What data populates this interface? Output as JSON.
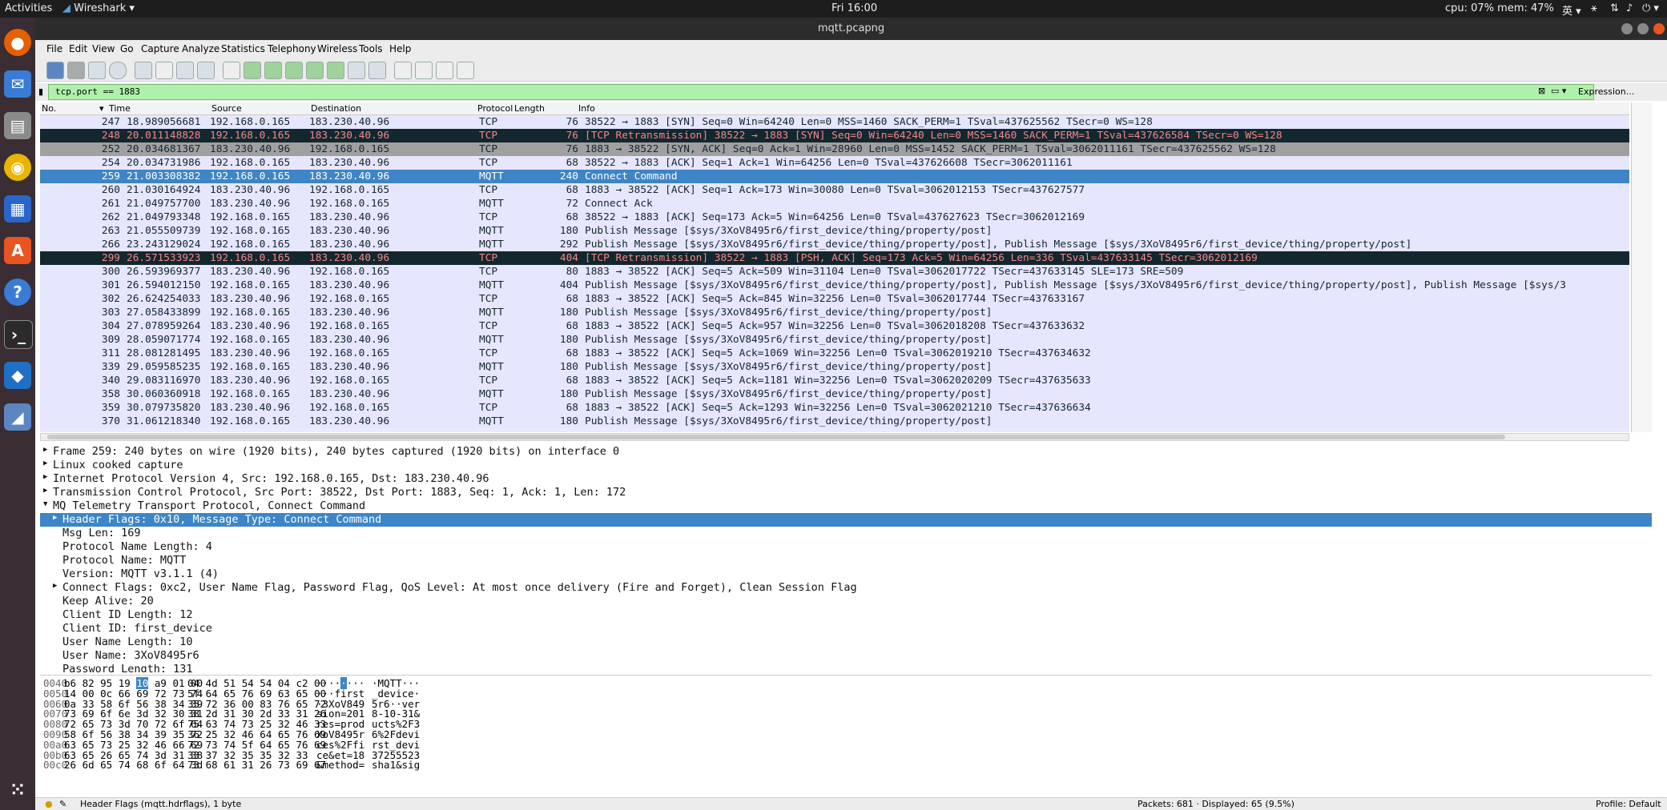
{
  "topbar": {
    "activities": "Activities",
    "app": "Wireshark",
    "clock": "Fri 16:00",
    "sysinfo": "cpu: 07% mem: 47%",
    "lang": "英"
  },
  "window": {
    "title": "mqtt.pcapng"
  },
  "menu": [
    "File",
    "Edit",
    "View",
    "Go",
    "Capture",
    "Analyze",
    "Statistics",
    "Telephony",
    "Wireless",
    "Tools",
    "Help"
  ],
  "filter": {
    "value": "tcp.port == 1883",
    "expression_label": "Expression..."
  },
  "packet_list": {
    "columns": [
      "No.",
      "Time",
      "Source",
      "Destination",
      "Protocol",
      "Length",
      "Info"
    ],
    "rows": [
      {
        "no": "247",
        "time": "18.989056681",
        "src": "192.168.0.165",
        "dst": "183.230.40.96",
        "proto": "TCP",
        "len": "76",
        "info": "38522 → 1883 [SYN] Seq=0 Win=64240 Len=0 MSS=1460 SACK_PERM=1 TSval=437625562 TSecr=0 WS=128",
        "style": "r-tcp"
      },
      {
        "no": "248",
        "time": "20.011148828",
        "src": "192.168.0.165",
        "dst": "183.230.40.96",
        "proto": "TCP",
        "len": "76",
        "info": "[TCP Retransmission] 38522 → 1883 [SYN] Seq=0 Win=64240 Len=0 MSS=1460 SACK_PERM=1 TSval=437626584 TSecr=0 WS=128",
        "style": "r-retrans"
      },
      {
        "no": "252",
        "time": "20.034681367",
        "src": "183.230.40.96",
        "dst": "192.168.0.165",
        "proto": "TCP",
        "len": "76",
        "info": "1883 → 38522 [SYN, ACK] Seq=0 Ack=1 Win=28960 Len=0 MSS=1452 SACK_PERM=1 TSval=3062011161 TSecr=437625562 WS=128",
        "style": "r-synack"
      },
      {
        "no": "254",
        "time": "20.034731986",
        "src": "192.168.0.165",
        "dst": "183.230.40.96",
        "proto": "TCP",
        "len": "68",
        "info": "38522 → 1883 [ACK] Seq=1 Ack=1 Win=64256 Len=0 TSval=437626608 TSecr=3062011161",
        "style": "r-tcp"
      },
      {
        "no": "259",
        "time": "21.003308382",
        "src": "192.168.0.165",
        "dst": "183.230.40.96",
        "proto": "MQTT",
        "len": "240",
        "info": "Connect Command",
        "style": "r-selected"
      },
      {
        "no": "260",
        "time": "21.030164924",
        "src": "183.230.40.96",
        "dst": "192.168.0.165",
        "proto": "TCP",
        "len": "68",
        "info": "1883 → 38522 [ACK] Seq=1 Ack=173 Win=30080 Len=0 TSval=3062012153 TSecr=437627577",
        "style": "r-tcp"
      },
      {
        "no": "261",
        "time": "21.049757700",
        "src": "183.230.40.96",
        "dst": "192.168.0.165",
        "proto": "MQTT",
        "len": "72",
        "info": "Connect Ack",
        "style": "r-mqtt"
      },
      {
        "no": "262",
        "time": "21.049793348",
        "src": "192.168.0.165",
        "dst": "183.230.40.96",
        "proto": "TCP",
        "len": "68",
        "info": "38522 → 1883 [ACK] Seq=173 Ack=5 Win=64256 Len=0 TSval=437627623 TSecr=3062012169",
        "style": "r-tcp"
      },
      {
        "no": "263",
        "time": "21.055509739",
        "src": "192.168.0.165",
        "dst": "183.230.40.96",
        "proto": "MQTT",
        "len": "180",
        "info": "Publish Message [$sys/3XoV8495r6/first_device/thing/property/post]",
        "style": "r-mqtt"
      },
      {
        "no": "266",
        "time": "23.243129024",
        "src": "192.168.0.165",
        "dst": "183.230.40.96",
        "proto": "MQTT",
        "len": "292",
        "info": "Publish Message [$sys/3XoV8495r6/first_device/thing/property/post], Publish Message [$sys/3XoV8495r6/first_device/thing/property/post]",
        "style": "r-mqtt"
      },
      {
        "no": "299",
        "time": "26.571533923",
        "src": "192.168.0.165",
        "dst": "183.230.40.96",
        "proto": "TCP",
        "len": "404",
        "info": "[TCP Retransmission] 38522 → 1883 [PSH, ACK] Seq=173 Ack=5 Win=64256 Len=336 TSval=437633145 TSecr=3062012169",
        "style": "r-retrans"
      },
      {
        "no": "300",
        "time": "26.593969377",
        "src": "183.230.40.96",
        "dst": "192.168.0.165",
        "proto": "TCP",
        "len": "80",
        "info": "1883 → 38522 [ACK] Seq=5 Ack=509 Win=31104 Len=0 TSval=3062017722 TSecr=437633145 SLE=173 SRE=509",
        "style": "r-tcp"
      },
      {
        "no": "301",
        "time": "26.594012150",
        "src": "192.168.0.165",
        "dst": "183.230.40.96",
        "proto": "MQTT",
        "len": "404",
        "info": "Publish Message [$sys/3XoV8495r6/first_device/thing/property/post], Publish Message [$sys/3XoV8495r6/first_device/thing/property/post], Publish Message [$sys/3",
        "style": "r-mqtt"
      },
      {
        "no": "302",
        "time": "26.624254033",
        "src": "183.230.40.96",
        "dst": "192.168.0.165",
        "proto": "TCP",
        "len": "68",
        "info": "1883 → 38522 [ACK] Seq=5 Ack=845 Win=32256 Len=0 TSval=3062017744 TSecr=437633167",
        "style": "r-tcp"
      },
      {
        "no": "303",
        "time": "27.058433899",
        "src": "192.168.0.165",
        "dst": "183.230.40.96",
        "proto": "MQTT",
        "len": "180",
        "info": "Publish Message [$sys/3XoV8495r6/first_device/thing/property/post]",
        "style": "r-mqtt"
      },
      {
        "no": "304",
        "time": "27.078959264",
        "src": "183.230.40.96",
        "dst": "192.168.0.165",
        "proto": "TCP",
        "len": "68",
        "info": "1883 → 38522 [ACK] Seq=5 Ack=957 Win=32256 Len=0 TSval=3062018208 TSecr=437633632",
        "style": "r-tcp"
      },
      {
        "no": "309",
        "time": "28.059071774",
        "src": "192.168.0.165",
        "dst": "183.230.40.96",
        "proto": "MQTT",
        "len": "180",
        "info": "Publish Message [$sys/3XoV8495r6/first_device/thing/property/post]",
        "style": "r-mqtt"
      },
      {
        "no": "311",
        "time": "28.081281495",
        "src": "183.230.40.96",
        "dst": "192.168.0.165",
        "proto": "TCP",
        "len": "68",
        "info": "1883 → 38522 [ACK] Seq=5 Ack=1069 Win=32256 Len=0 TSval=3062019210 TSecr=437634632",
        "style": "r-tcp"
      },
      {
        "no": "339",
        "time": "29.059585235",
        "src": "192.168.0.165",
        "dst": "183.230.40.96",
        "proto": "MQTT",
        "len": "180",
        "info": "Publish Message [$sys/3XoV8495r6/first_device/thing/property/post]",
        "style": "r-mqtt"
      },
      {
        "no": "340",
        "time": "29.083116970",
        "src": "183.230.40.96",
        "dst": "192.168.0.165",
        "proto": "TCP",
        "len": "68",
        "info": "1883 → 38522 [ACK] Seq=5 Ack=1181 Win=32256 Len=0 TSval=3062020209 TSecr=437635633",
        "style": "r-tcp"
      },
      {
        "no": "358",
        "time": "30.060360918",
        "src": "192.168.0.165",
        "dst": "183.230.40.96",
        "proto": "MQTT",
        "len": "180",
        "info": "Publish Message [$sys/3XoV8495r6/first_device/thing/property/post]",
        "style": "r-mqtt"
      },
      {
        "no": "359",
        "time": "30.079735820",
        "src": "183.230.40.96",
        "dst": "192.168.0.165",
        "proto": "TCP",
        "len": "68",
        "info": "1883 → 38522 [ACK] Seq=5 Ack=1293 Win=32256 Len=0 TSval=3062021210 TSecr=437636634",
        "style": "r-tcp"
      },
      {
        "no": "370",
        "time": "31.061218340",
        "src": "192.168.0.165",
        "dst": "183.230.40.96",
        "proto": "MQTT",
        "len": "180",
        "info": "Publish Message [$sys/3XoV8495r6/first_device/thing/property/post]",
        "style": "r-mqtt"
      }
    ]
  },
  "details": [
    {
      "indent": 0,
      "arrow": "▶",
      "text": "Frame 259: 240 bytes on wire (1920 bits), 240 bytes captured (1920 bits) on interface 0",
      "sel": false
    },
    {
      "indent": 0,
      "arrow": "▶",
      "text": "Linux cooked capture",
      "sel": false
    },
    {
      "indent": 0,
      "arrow": "▶",
      "text": "Internet Protocol Version 4, Src: 192.168.0.165, Dst: 183.230.40.96",
      "sel": false
    },
    {
      "indent": 0,
      "arrow": "▶",
      "text": "Transmission Control Protocol, Src Port: 38522, Dst Port: 1883, Seq: 1, Ack: 1, Len: 172",
      "sel": false
    },
    {
      "indent": 0,
      "arrow": "▼",
      "text": "MQ Telemetry Transport Protocol, Connect Command",
      "sel": false
    },
    {
      "indent": 1,
      "arrow": "▶",
      "text": "Header Flags: 0x10, Message Type: Connect Command",
      "sel": true
    },
    {
      "indent": 1,
      "arrow": "",
      "text": "Msg Len: 169",
      "sel": false
    },
    {
      "indent": 1,
      "arrow": "",
      "text": "Protocol Name Length: 4",
      "sel": false
    },
    {
      "indent": 1,
      "arrow": "",
      "text": "Protocol Name: MQTT",
      "sel": false
    },
    {
      "indent": 1,
      "arrow": "",
      "text": "Version: MQTT v3.1.1 (4)",
      "sel": false
    },
    {
      "indent": 1,
      "arrow": "▶",
      "text": "Connect Flags: 0xc2, User Name Flag, Password Flag, QoS Level: At most once delivery (Fire and Forget), Clean Session Flag",
      "sel": false
    },
    {
      "indent": 1,
      "arrow": "",
      "text": "Keep Alive: 20",
      "sel": false
    },
    {
      "indent": 1,
      "arrow": "",
      "text": "Client ID Length: 12",
      "sel": false
    },
    {
      "indent": 1,
      "arrow": "",
      "text": "Client ID: first_device",
      "sel": false
    },
    {
      "indent": 1,
      "arrow": "",
      "text": "User Name Length: 10",
      "sel": false
    },
    {
      "indent": 1,
      "arrow": "",
      "text": "User Name: 3XoV8495r6",
      "sel": false
    },
    {
      "indent": 1,
      "arrow": "",
      "text": "Password Length: 131",
      "sel": false
    }
  ],
  "bytes": [
    {
      "off": "0040",
      "hexA": "b6 82 95 19 ",
      "hl": "10",
      "hexB": " a9 01 00",
      "hexC": "04 4d 51 54 54 04 c2 00",
      "ascA": "····",
      "ascHl": "·",
      "ascB": "···",
      "ascC": "·MQTT···"
    },
    {
      "off": "0050",
      "hexA": "14 00 0c 66 69 72 73 74",
      "hl": "",
      "hexB": "",
      "hexC": "5f 64 65 76 69 63 65 00",
      "ascA": "···first",
      "ascHl": "",
      "ascB": "",
      "ascC": "_device·"
    },
    {
      "off": "0060",
      "hexA": "0a 33 58 6f 56 38 34 39",
      "hl": "",
      "hexB": "",
      "hexC": "35 72 36 00 83 76 65 72",
      "ascA": "·3XoV849",
      "ascHl": "",
      "ascB": "",
      "ascC": "5r6··ver"
    },
    {
      "off": "0070",
      "hexA": "73 69 6f 6e 3d 32 30 31",
      "hl": "",
      "hexB": "",
      "hexC": "38 2d 31 30 2d 33 31 26",
      "ascA": "sion=201",
      "ascHl": "",
      "ascB": "",
      "ascC": "8-10-31&"
    },
    {
      "off": "0080",
      "hexA": "72 65 73 3d 70 72 6f 64",
      "hl": "",
      "hexB": "",
      "hexC": "75 63 74 73 25 32 46 33",
      "ascA": "res=prod",
      "ascHl": "",
      "ascB": "",
      "ascC": "ucts%2F3"
    },
    {
      "off": "0090",
      "hexA": "58 6f 56 38 34 39 35 72",
      "hl": "",
      "hexB": "",
      "hexC": "36 25 32 46 64 65 76 69",
      "ascA": "XoV8495r",
      "ascHl": "",
      "ascB": "",
      "ascC": "6%2Fdevi"
    },
    {
      "off": "00a0",
      "hexA": "63 65 73 25 32 46 66 69",
      "hl": "",
      "hexB": "",
      "hexC": "72 73 74 5f 64 65 76 69",
      "ascA": "ces%2Ffi",
      "ascHl": "",
      "ascB": "",
      "ascC": "rst_devi"
    },
    {
      "off": "00b0",
      "hexA": "63 65 26 65 74 3d 31 38",
      "hl": "",
      "hexB": "",
      "hexC": "33 37 32 35 35 32 33",
      "ascA": "ce&et=18",
      "ascHl": "",
      "ascB": "",
      "ascC": "37255523"
    },
    {
      "off": "00c0",
      "hexA": "26 6d 65 74 68 6f 64 3d",
      "hl": "",
      "hexB": "",
      "hexC": "73 68 61 31 26 73 69 67",
      "ascA": "&method=",
      "ascHl": "",
      "ascB": "",
      "ascC": "sha1&sig"
    }
  ],
  "status": {
    "field": "Header Flags (mqtt.hdrflags), 1 byte",
    "packets": "Packets: 681 · Displayed: 65 (9.5%)",
    "profile": "Profile: Default"
  }
}
